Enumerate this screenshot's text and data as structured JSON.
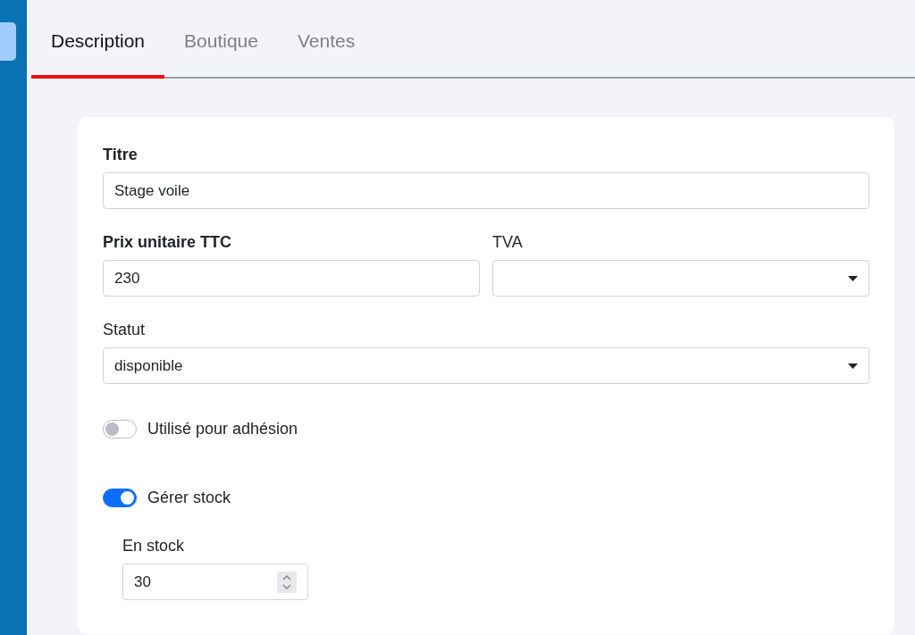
{
  "tabs": [
    {
      "label": "Description",
      "selected": true
    },
    {
      "label": "Boutique",
      "selected": false
    },
    {
      "label": "Ventes",
      "selected": false
    }
  ],
  "form": {
    "title": {
      "label": "Titre",
      "bold": true,
      "value": "Stage voile"
    },
    "price": {
      "label": "Prix unitaire TTC",
      "bold": true,
      "value": "230"
    },
    "vat": {
      "label": "TVA",
      "bold": false
    },
    "status": {
      "label": "Statut",
      "bold": false,
      "value": "disponible"
    },
    "toggles": [
      {
        "label": "Utilisé pour adhésion",
        "on": false
      },
      {
        "label": "Gérer stock",
        "on": true
      }
    ],
    "stock": {
      "label": "En stock",
      "value": "30"
    }
  }
}
